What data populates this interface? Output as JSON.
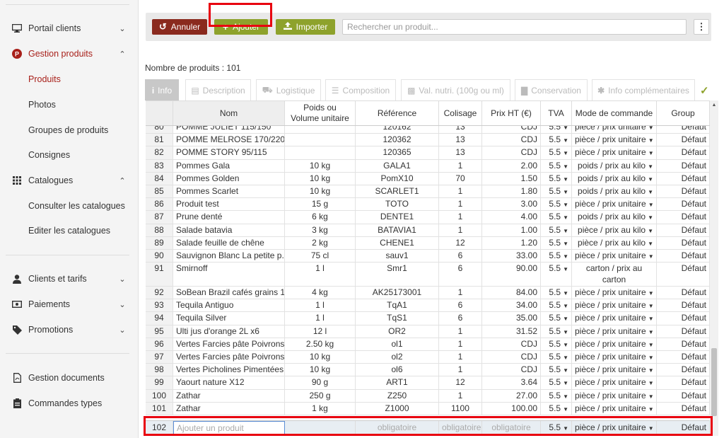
{
  "sidebar": {
    "items": [
      {
        "label": "Portail clients",
        "icon": "monitor-icon"
      },
      {
        "label": "Gestion produits",
        "icon": "product-icon"
      },
      {
        "label": "Catalogues",
        "icon": "grid-icon"
      },
      {
        "label": "Clients et tarifs",
        "icon": "user-icon"
      },
      {
        "label": "Paiements",
        "icon": "money-icon"
      },
      {
        "label": "Promotions",
        "icon": "tag-icon"
      },
      {
        "label": "Gestion documents",
        "icon": "pdf-icon"
      },
      {
        "label": "Commandes types",
        "icon": "clipboard-icon"
      }
    ],
    "gestion_sub": [
      "Produits",
      "Photos",
      "Groupes de produits",
      "Consignes"
    ],
    "catalogue_sub": [
      "Consulter les catalogues",
      "Editer les catalogues"
    ]
  },
  "toolbar": {
    "cancel_label": "Annuler",
    "add_label": "Ajouter",
    "import_label": "Importer",
    "search_placeholder": "Rechercher un produit...",
    "more_label": "⋮"
  },
  "count_label": "Nombre de produits : 101",
  "tabs": [
    {
      "label": "Info",
      "icon": "info-icon"
    },
    {
      "label": "Description",
      "icon": "document-icon"
    },
    {
      "label": "Logistique",
      "icon": "truck-icon"
    },
    {
      "label": "Composition",
      "icon": "list-icon"
    },
    {
      "label": "Val. nutri. (100g ou ml)",
      "icon": "chart-icon"
    },
    {
      "label": "Conservation",
      "icon": "thermometer-icon"
    },
    {
      "label": "Info complémentaires",
      "icon": "asterisk-icon"
    }
  ],
  "columns": {
    "nom": "Nom",
    "poids_1": "Poids ou",
    "poids_2": "Volume unitaire",
    "ref": "Référence",
    "col": "Colisage",
    "prix": "Prix HT (€)",
    "tva": "TVA",
    "mode": "Mode de commande",
    "grp": "Group"
  },
  "rows": [
    {
      "idx": "80",
      "nom": "POMME JULIET 115/150",
      "poids": "",
      "ref": "120162",
      "col": "13",
      "prix": "CDJ",
      "tva": "5.5",
      "mode": "pièce / prix unitaire",
      "grp": "Défaut"
    },
    {
      "idx": "81",
      "nom": "POMME MELROSE 170/220",
      "poids": "",
      "ref": "120362",
      "col": "13",
      "prix": "CDJ",
      "tva": "5.5",
      "mode": "pièce / prix unitaire",
      "grp": "Défaut"
    },
    {
      "idx": "82",
      "nom": "POMME STORY 95/115",
      "poids": "",
      "ref": "120365",
      "col": "13",
      "prix": "CDJ",
      "tva": "5.5",
      "mode": "pièce / prix unitaire",
      "grp": "Défaut"
    },
    {
      "idx": "83",
      "nom": "Pommes Gala",
      "poids": "10 kg",
      "ref": "GALA1",
      "col": "1",
      "prix": "2.00",
      "tva": "5.5",
      "mode": "poids / prix au kilo",
      "grp": "Défaut"
    },
    {
      "idx": "84",
      "nom": "Pommes Golden",
      "poids": "10 kg",
      "ref": "PomX10",
      "col": "70",
      "prix": "1.50",
      "tva": "5.5",
      "mode": "poids / prix au kilo",
      "grp": "Défaut"
    },
    {
      "idx": "85",
      "nom": "Pommes Scarlet",
      "poids": "10 kg",
      "ref": "SCARLET1",
      "col": "1",
      "prix": "1.80",
      "tva": "5.5",
      "mode": "poids / prix au kilo",
      "grp": "Défaut"
    },
    {
      "idx": "86",
      "nom": "Produit test",
      "poids": "15 g",
      "ref": "TOTO",
      "col": "1",
      "prix": "3.00",
      "tva": "5.5",
      "mode": "pièce / prix unitaire",
      "grp": "Défaut"
    },
    {
      "idx": "87",
      "nom": "Prune denté",
      "poids": "6 kg",
      "ref": "DENTE1",
      "col": "1",
      "prix": "4.00",
      "tva": "5.5",
      "mode": "poids / prix au kilo",
      "grp": "Défaut"
    },
    {
      "idx": "88",
      "nom": "Salade batavia",
      "poids": "3 kg",
      "ref": "BATAVIA1",
      "col": "1",
      "prix": "1.00",
      "tva": "5.5",
      "mode": "pièce / prix au kilo",
      "grp": "Défaut"
    },
    {
      "idx": "89",
      "nom": "Salade feuille de chêne",
      "poids": "2 kg",
      "ref": "CHENE1",
      "col": "12",
      "prix": "1.20",
      "tva": "5.5",
      "mode": "pièce / prix au kilo",
      "grp": "Défaut"
    },
    {
      "idx": "90",
      "nom": "Sauvignon Blanc La petite p...",
      "poids": "75 cl",
      "ref": "sauv1",
      "col": "6",
      "prix": "33.00",
      "tva": "5.5",
      "mode": "pièce / prix unitaire",
      "grp": "Défaut"
    },
    {
      "idx": "91",
      "nom": "Smirnoff",
      "poids": "1 l",
      "ref": "Smr1",
      "col": "6",
      "prix": "90.00",
      "tva": "5.5",
      "mode": "carton / prix au carton",
      "grp": "Défaut",
      "tall": true
    },
    {
      "idx": "92",
      "nom": "SoBean Brazil cafés grains 1...",
      "poids": "4 kg",
      "ref": "AK25173001",
      "col": "1",
      "prix": "84.00",
      "tva": "5.5",
      "mode": "pièce / prix unitaire",
      "grp": "Défaut"
    },
    {
      "idx": "93",
      "nom": "Tequila Antiguo",
      "poids": "1 l",
      "ref": "TqA1",
      "col": "6",
      "prix": "34.00",
      "tva": "5.5",
      "mode": "pièce / prix unitaire",
      "grp": "Défaut"
    },
    {
      "idx": "94",
      "nom": "Tequila Silver",
      "poids": "1 l",
      "ref": "TqS1",
      "col": "6",
      "prix": "35.00",
      "tva": "5.5",
      "mode": "pièce / prix unitaire",
      "grp": "Défaut"
    },
    {
      "idx": "95",
      "nom": "Ulti jus d'orange 2L x6",
      "poids": "12 l",
      "ref": "OR2",
      "col": "1",
      "prix": "31.52",
      "tva": "5.5",
      "mode": "pièce / prix unitaire",
      "grp": "Défaut"
    },
    {
      "idx": "96",
      "nom": "Vertes Farcies pâte Poivrons",
      "poids": "2.50 kg",
      "ref": "ol1",
      "col": "1",
      "prix": "CDJ",
      "tva": "5.5",
      "mode": "pièce / prix unitaire",
      "grp": "Défaut"
    },
    {
      "idx": "97",
      "nom": "Vertes Farcies pâte Poivrons",
      "poids": "10 kg",
      "ref": "ol2",
      "col": "1",
      "prix": "CDJ",
      "tva": "5.5",
      "mode": "pièce / prix unitaire",
      "grp": "Défaut"
    },
    {
      "idx": "98",
      "nom": "Vertes Picholines Pimentées",
      "poids": "10 kg",
      "ref": "ol6",
      "col": "1",
      "prix": "CDJ",
      "tva": "5.5",
      "mode": "pièce / prix unitaire",
      "grp": "Défaut"
    },
    {
      "idx": "99",
      "nom": "Yaourt nature X12",
      "poids": "90 g",
      "ref": "ART1",
      "col": "12",
      "prix": "3.64",
      "tva": "5.5",
      "mode": "pièce / prix unitaire",
      "grp": "Défaut"
    },
    {
      "idx": "100",
      "nom": "Zathar",
      "poids": "250 g",
      "ref": "Z250",
      "col": "1",
      "prix": "27.00",
      "tva": "5.5",
      "mode": "pièce / prix unitaire",
      "grp": "Défaut"
    },
    {
      "idx": "101",
      "nom": "Zathar",
      "poids": "1 kg",
      "ref": "Z1000",
      "col": "1100",
      "prix": "100.00",
      "tva": "5.5",
      "mode": "pièce / prix unitaire",
      "grp": "Défaut"
    }
  ],
  "new_row": {
    "idx": "102",
    "nom_placeholder": "Ajouter un produit",
    "ref": "obligatoire",
    "col": "obligatoire",
    "prix": "obligatoire",
    "tva": "5.5",
    "mode": "pièce / prix unitaire",
    "grp": "Défaut"
  },
  "colors": {
    "accent_red": "#a8201a",
    "cancel_bg": "#8a2a1e",
    "green": "#8ea22c",
    "highlight": "#e8000f"
  }
}
